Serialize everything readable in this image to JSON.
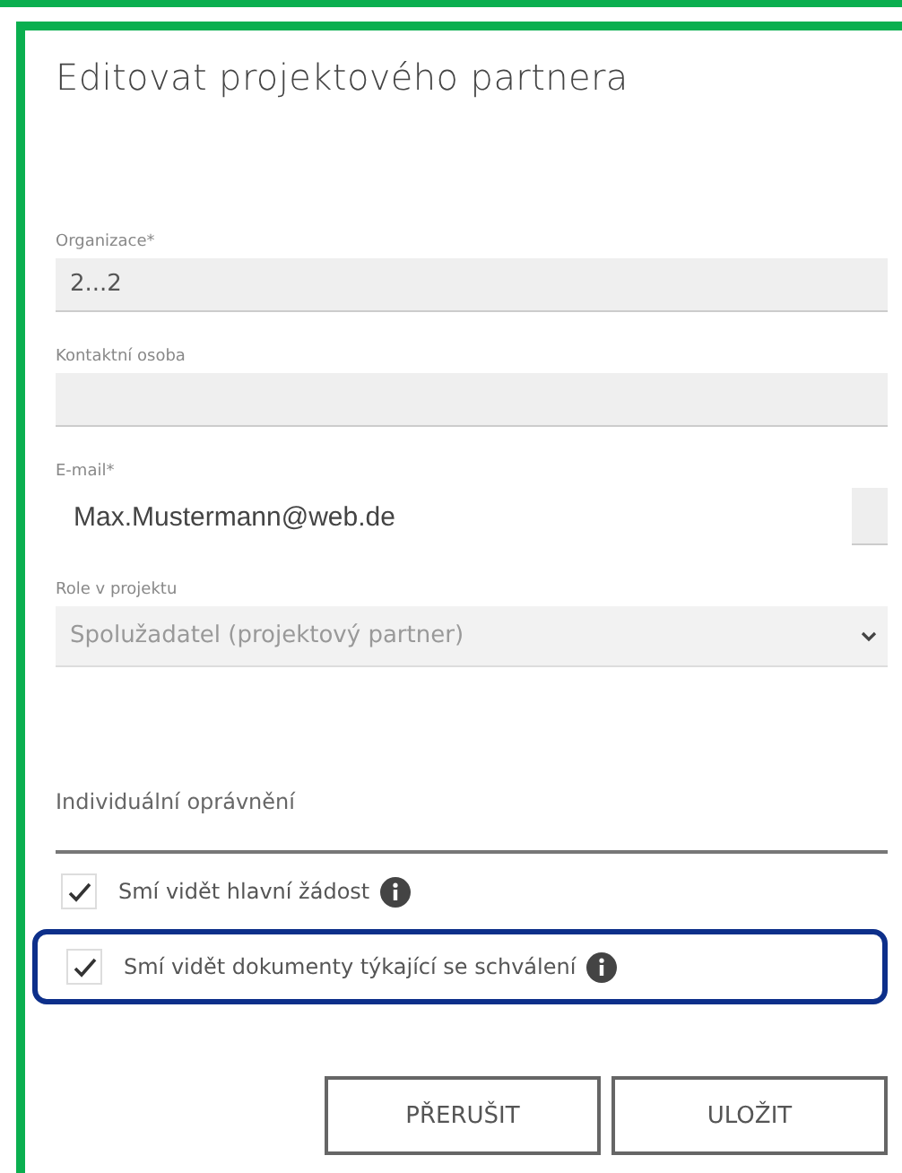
{
  "dialog": {
    "title": "Editovat projektového partnera"
  },
  "fields": [
    {
      "kind": "text",
      "label": "Organizace*",
      "value": "2...2"
    },
    {
      "kind": "text",
      "label": "Kontaktní osoba"
    },
    {
      "kind": "email",
      "label": "E-mail*",
      "value": "Max.Mustermann@web.de"
    },
    {
      "kind": "select",
      "label": "Role v projektu",
      "value": "Spolužadatel (projektový partner)"
    }
  ],
  "permissions": {
    "heading": "Individuální oprávnění",
    "items": [
      {
        "label": "Smí vidět hlavní žádost",
        "checked": true,
        "highlighted": false
      },
      {
        "label": "Smí vidět dokumenty týkající se schválení",
        "checked": true,
        "highlighted": true
      }
    ]
  },
  "buttons": [
    "PŘERUŠIT",
    "ULOŽIT"
  ]
}
